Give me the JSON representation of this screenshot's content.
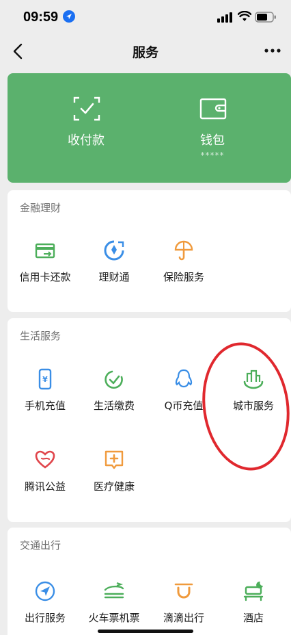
{
  "status": {
    "time": "09:59"
  },
  "nav": {
    "title": "服务"
  },
  "banner": {
    "pay_label": "收付款",
    "wallet_label": "钱包",
    "wallet_balance_mask": "*****"
  },
  "finance": {
    "title": "金融理财",
    "items": [
      {
        "label": "信用卡还款",
        "icon": "credit-card-repay-icon"
      },
      {
        "label": "理财通",
        "icon": "wealth-icon"
      },
      {
        "label": "保险服务",
        "icon": "insurance-icon"
      }
    ]
  },
  "life": {
    "title": "生活服务",
    "items": [
      {
        "label": "手机充值",
        "icon": "phone-recharge-icon"
      },
      {
        "label": "生活缴费",
        "icon": "utility-payment-icon"
      },
      {
        "label": "Q币充值",
        "icon": "qq-coin-icon"
      },
      {
        "label": "城市服务",
        "icon": "city-service-icon"
      },
      {
        "label": "腾讯公益",
        "icon": "charity-icon"
      },
      {
        "label": "医疗健康",
        "icon": "medical-icon"
      }
    ]
  },
  "travel": {
    "title": "交通出行",
    "items": [
      {
        "label": "出行服务",
        "icon": "travel-service-icon"
      },
      {
        "label": "火车票机票",
        "icon": "train-ticket-icon"
      },
      {
        "label": "滴滴出行",
        "icon": "didi-icon"
      },
      {
        "label": "酒店",
        "icon": "hotel-icon"
      }
    ]
  },
  "colors": {
    "banner_green": "#5bb16d",
    "icon_green": "#4cae5a",
    "icon_blue": "#3a8ee6",
    "icon_orange": "#f09a3c",
    "icon_red": "#e0454b",
    "annotation_red": "#e0282e"
  }
}
